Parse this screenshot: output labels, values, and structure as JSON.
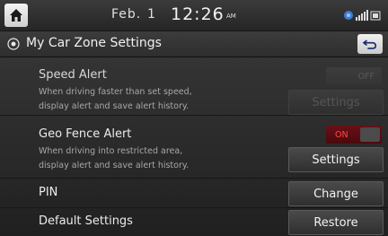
{
  "status_bar": {
    "date": "Feb.",
    "day": "1",
    "time": "12:26",
    "ampm": "AM"
  },
  "header": {
    "title": "My Car Zone Settings"
  },
  "rows": [
    {
      "title": "Speed Alert",
      "desc_line1": "When driving faster than set speed,",
      "desc_line2": "display alert and save alert history.",
      "toggle": "OFF",
      "button": "Settings"
    },
    {
      "title": "Geo Fence Alert",
      "desc_line1": "When driving into restricted area,",
      "desc_line2": "display alert and save alert history.",
      "toggle": "ON",
      "button": "Settings"
    },
    {
      "title": "PIN",
      "button": "Change"
    },
    {
      "title": "Default Settings",
      "button": "Restore"
    }
  ],
  "colors": {
    "toggle_on": "#d62a2a",
    "background": "#2b2b2b"
  },
  "icons": [
    "home-icon",
    "navigation-target-icon",
    "back-icon",
    "signal-icon"
  ]
}
